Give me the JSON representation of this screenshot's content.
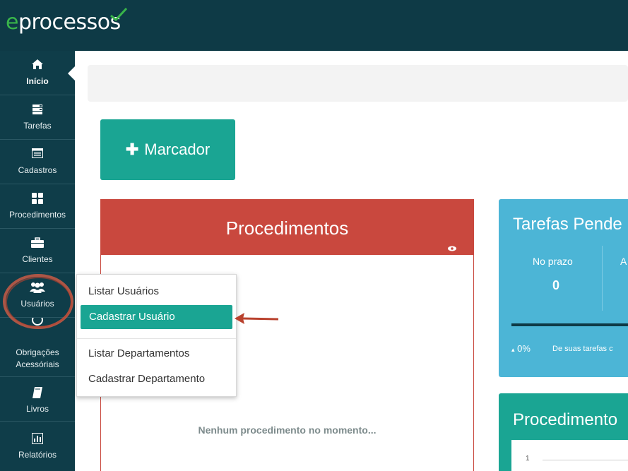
{
  "app": {
    "logo_prefix": "e",
    "logo_rest": "processos",
    "brand_color": "#0e3a46",
    "accent": "#1aa593"
  },
  "sidebar": {
    "items": [
      {
        "label": "Início",
        "icon": "home-icon",
        "active": true
      },
      {
        "label": "Tarefas",
        "icon": "tasks-icon"
      },
      {
        "label": "Cadastros",
        "icon": "list-icon"
      },
      {
        "label": "Procedimentos",
        "icon": "grid-icon"
      },
      {
        "label": "Clientes",
        "icon": "briefcase-icon"
      },
      {
        "label": "Usuários",
        "icon": "users-icon"
      },
      {
        "label": "Obrigações Acessóriais",
        "icon": "obligations-icon"
      },
      {
        "label": "Livros",
        "icon": "book-icon"
      },
      {
        "label": "Relatórios",
        "icon": "chart-icon"
      }
    ]
  },
  "main": {
    "marcador_button": "Marcador",
    "procedimentos_panel": {
      "title": "Procedimentos",
      "empty_text": "Nenhum procedimento no momento...",
      "color": "#c9483e"
    },
    "tarefas_panel": {
      "title": "Tarefas Pende",
      "col1_label": "No prazo",
      "col1_value": "0",
      "col2_label": "A",
      "percent": "0%",
      "percent_desc": "De suas tarefas c",
      "color": "#4cb5d6"
    },
    "procedimentos_chart_panel": {
      "title": "Procedimento",
      "tick": "1"
    }
  },
  "dropdown": {
    "items": [
      "Listar Usuários",
      "Cadastrar Usuário",
      "Listar Departamentos",
      "Cadastrar Departamento"
    ],
    "highlighted": "Cadastrar Usuário"
  }
}
